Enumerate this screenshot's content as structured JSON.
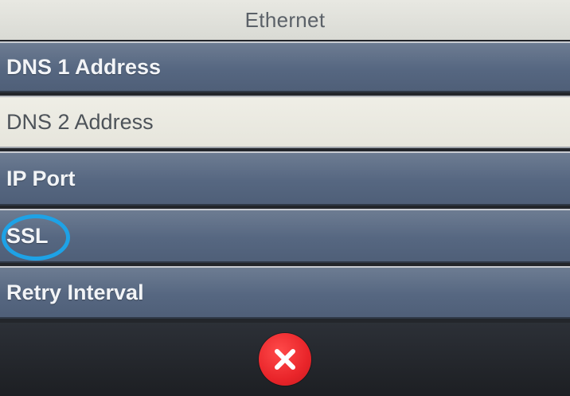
{
  "header": {
    "title": "Ethernet"
  },
  "menu": {
    "items": [
      {
        "label": "DNS 1 Address",
        "selected": false
      },
      {
        "label": "DNS 2 Address",
        "selected": true
      },
      {
        "label": "IP Port",
        "selected": false
      },
      {
        "label": "SSL",
        "selected": false
      },
      {
        "label": "Retry Interval",
        "selected": false
      }
    ]
  },
  "annotation": {
    "ring_color": "#1ea2e6",
    "circled_item": "SSL"
  },
  "footer": {
    "close_icon": "close-icon",
    "close_color": "#e9252a"
  }
}
